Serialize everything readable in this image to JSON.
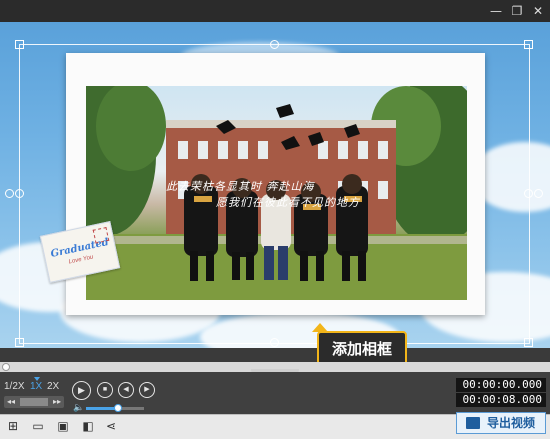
{
  "window": {
    "minimize_icon": "minimize-icon",
    "restore_icon": "restore-icon",
    "close_icon": "close-icon"
  },
  "preview": {
    "photo_caption_line1": "此去荣枯各显其时 奔赴山海",
    "photo_caption_line2": "愿我们在彼此看不见的地方",
    "postcard_text": "Graduated",
    "postcard_sub": "Love You"
  },
  "tooltip": {
    "label": "添加相框"
  },
  "speed": {
    "options": [
      "1/2X",
      "1X",
      "2X"
    ],
    "selected": "1X"
  },
  "playback": {
    "current_time": "00:00:00.000",
    "total_time": "00:00:08.000",
    "volume": 0.55
  },
  "toolbar": {
    "icons": [
      "new-project-icon",
      "open-folder-icon",
      "save-icon",
      "save-as-icon",
      "share-icon"
    ],
    "export_label": "导出视频"
  },
  "colors": {
    "accent": "#f2b51a",
    "export_border": "#5b9bd5",
    "speed_selected": "#4aa3e8"
  }
}
